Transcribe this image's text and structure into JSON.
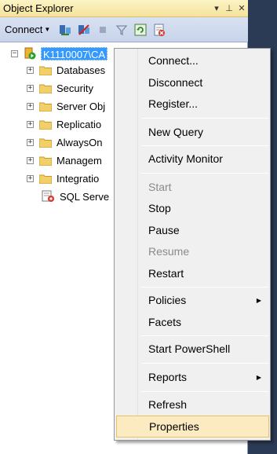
{
  "window": {
    "title": "Object Explorer",
    "pin_icon": "pin-icon",
    "close_icon": "close-icon"
  },
  "toolbar": {
    "connect_label": "Connect",
    "icons": [
      "connect-object-explorer-icon",
      "disconnect-icon",
      "stop-icon",
      "filter-icon",
      "refresh-icon",
      "new-query-icon"
    ]
  },
  "tree": {
    "server": {
      "label": "K1110007\\CA"
    },
    "items": [
      {
        "label": "Databases"
      },
      {
        "label": "Security"
      },
      {
        "label": "Server Obj"
      },
      {
        "label": "Replicatio"
      },
      {
        "label": "AlwaysOn"
      },
      {
        "label": "Managem"
      },
      {
        "label": "Integratio"
      }
    ],
    "agent": {
      "label": "SQL Serve"
    }
  },
  "context_menu": {
    "items": [
      {
        "label": "Connect...",
        "enabled": true
      },
      {
        "label": "Disconnect",
        "enabled": true
      },
      {
        "label": "Register...",
        "enabled": true
      },
      {
        "label": "New Query",
        "enabled": true
      },
      {
        "label": "Activity Monitor",
        "enabled": true
      },
      {
        "label": "Start",
        "enabled": false
      },
      {
        "label": "Stop",
        "enabled": true
      },
      {
        "label": "Pause",
        "enabled": true
      },
      {
        "label": "Resume",
        "enabled": false
      },
      {
        "label": "Restart",
        "enabled": true
      },
      {
        "label": "Policies",
        "enabled": true,
        "submenu": true
      },
      {
        "label": "Facets",
        "enabled": true
      },
      {
        "label": "Start PowerShell",
        "enabled": true
      },
      {
        "label": "Reports",
        "enabled": true,
        "submenu": true
      },
      {
        "label": "Refresh",
        "enabled": true
      },
      {
        "label": "Properties",
        "enabled": true,
        "highlighted": true
      }
    ]
  },
  "colors": {
    "selection": "#3399ff",
    "highlight": "#fcebc1",
    "title_bar": "#f5e39a"
  }
}
